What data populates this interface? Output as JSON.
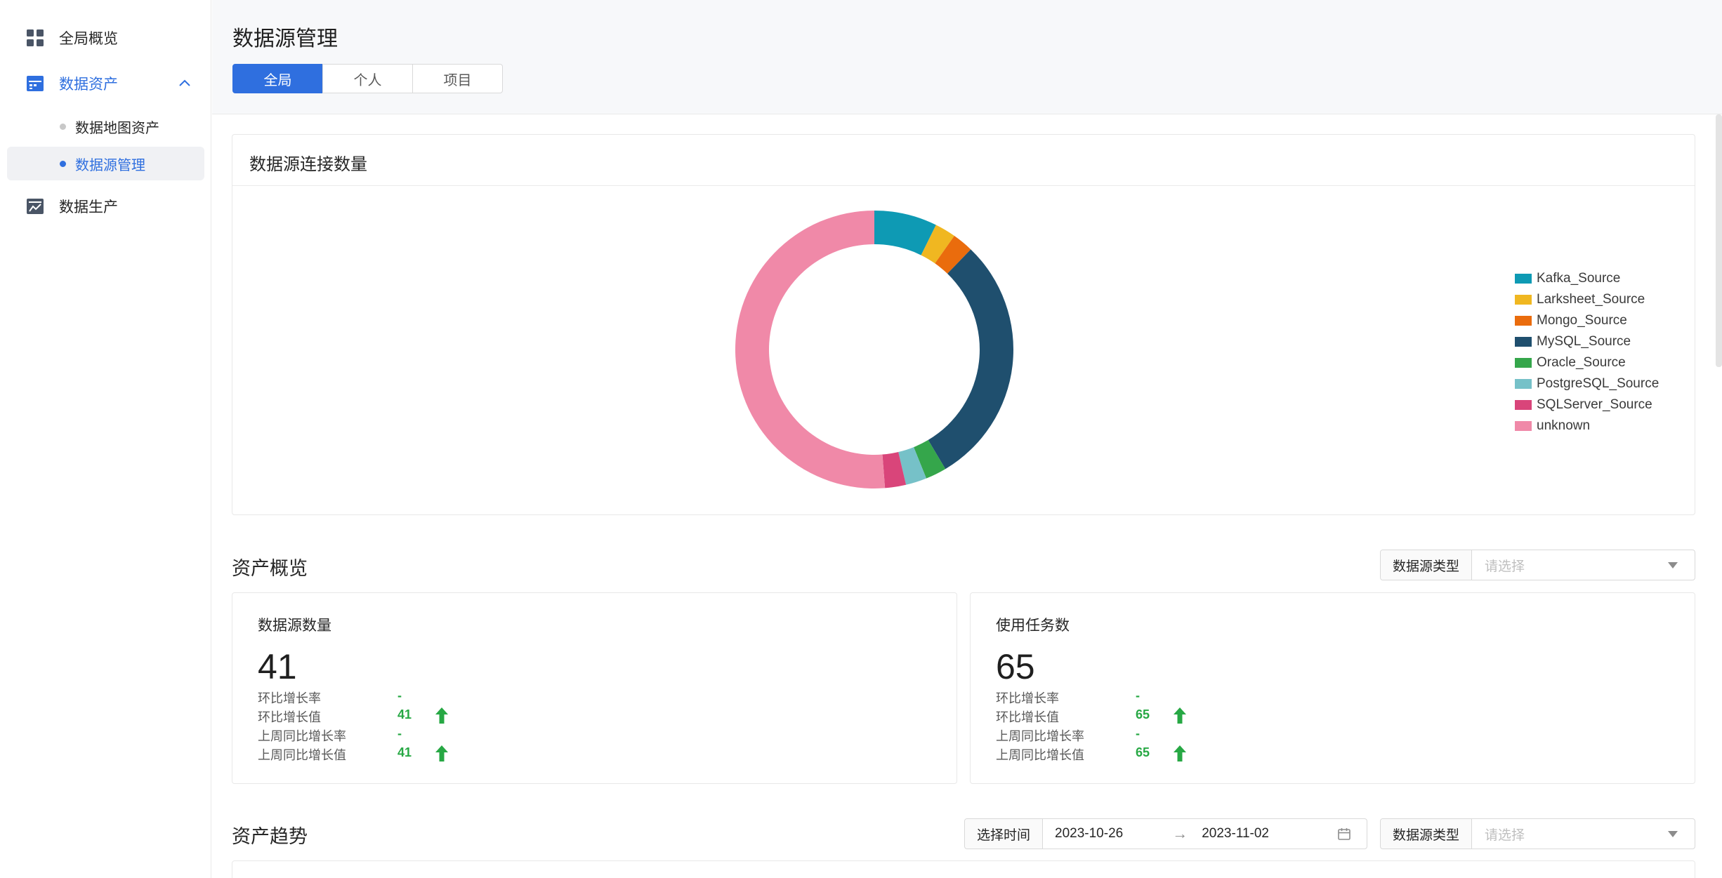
{
  "sidebar": {
    "items": [
      {
        "label": "全局概览",
        "icon": "dashboard-grid-icon"
      },
      {
        "label": "数据资产",
        "icon": "data-asset-icon",
        "expanded": true
      },
      {
        "label": "数据生产",
        "icon": "data-production-icon"
      }
    ],
    "sub_items": [
      {
        "label": "数据地图资产",
        "active": false
      },
      {
        "label": "数据源管理",
        "active": true
      }
    ]
  },
  "header": {
    "title": "数据源管理",
    "tabs": [
      {
        "label": "全局",
        "active": true
      },
      {
        "label": "个人",
        "active": false
      },
      {
        "label": "项目",
        "active": false
      }
    ]
  },
  "chart_card": {
    "title": "数据源连接数量"
  },
  "chart_data": {
    "type": "pie",
    "donut": true,
    "title": "数据源连接数量",
    "legend_position": "right",
    "categories": [
      "Kafka_Source",
      "Larksheet_Source",
      "Mongo_Source",
      "MySQL_Source",
      "Oracle_Source",
      "PostgreSQL_Source",
      "SQLServer_Source",
      "unknown"
    ],
    "values": [
      3,
      1,
      1,
      12,
      1,
      1,
      1,
      21
    ],
    "colors": [
      "#0e9ab4",
      "#f0b721",
      "#ea6c0d",
      "#1f4f6e",
      "#35a64b",
      "#76c1c8",
      "#d9457a",
      "#f089a8"
    ]
  },
  "overview": {
    "title": "资产概览",
    "filter_label": "数据源类型",
    "filter_placeholder": "请选择",
    "cards": [
      {
        "title": "数据源数量",
        "value": "41",
        "rows": [
          {
            "label": "环比增长率",
            "value": "-",
            "arrow": false
          },
          {
            "label": "环比增长值",
            "value": "41",
            "arrow": true
          },
          {
            "label": "上周同比增长率",
            "value": "-",
            "arrow": false
          },
          {
            "label": "上周同比增长值",
            "value": "41",
            "arrow": true
          }
        ]
      },
      {
        "title": "使用任务数",
        "value": "65",
        "rows": [
          {
            "label": "环比增长率",
            "value": "-",
            "arrow": false
          },
          {
            "label": "环比增长值",
            "value": "65",
            "arrow": true
          },
          {
            "label": "上周同比增长率",
            "value": "-",
            "arrow": false
          },
          {
            "label": "上周同比增长值",
            "value": "65",
            "arrow": true
          }
        ]
      }
    ]
  },
  "trend": {
    "title": "资产趋势",
    "time_label": "选择时间",
    "start_date": "2023-10-26",
    "end_date": "2023-11-02",
    "separator": "→",
    "filter_label": "数据源类型",
    "filter_placeholder": "请选择"
  },
  "colors": {
    "accent": "#2f6fdf",
    "positive": "#27a844"
  }
}
